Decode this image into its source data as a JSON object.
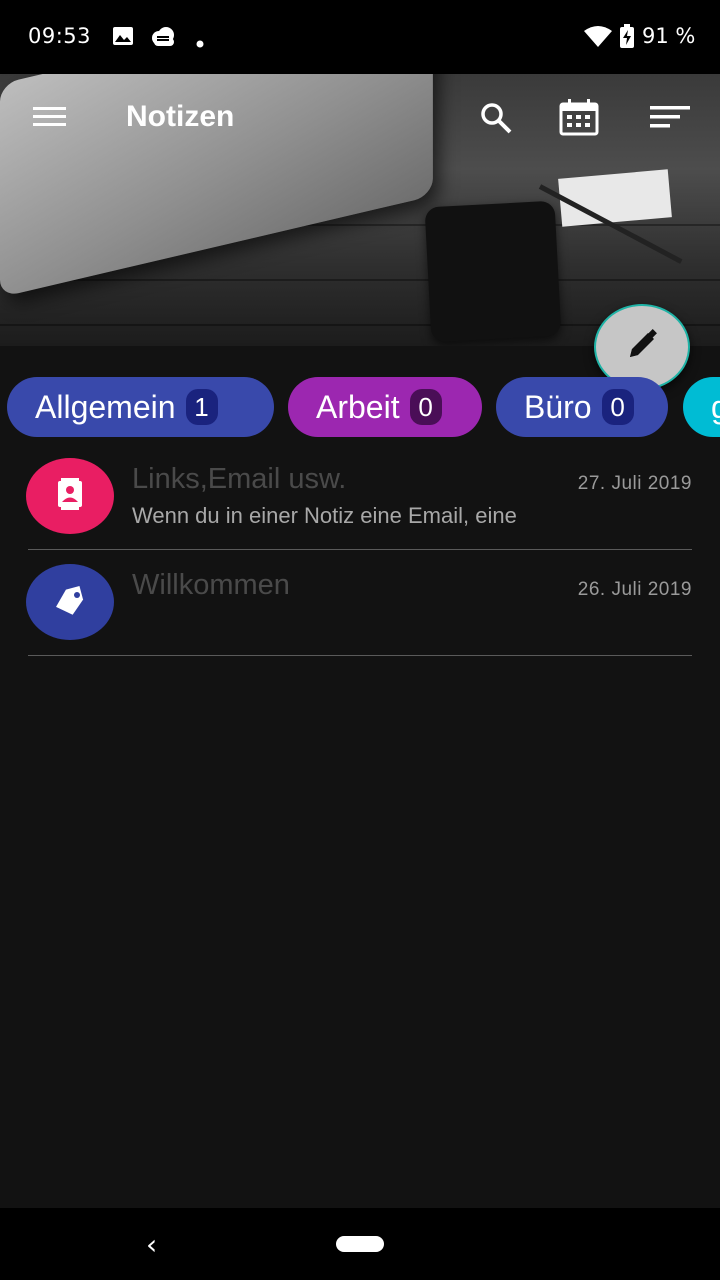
{
  "status_bar": {
    "time": "09:53",
    "battery": "91 %",
    "icons": [
      "image-icon",
      "cloud-icon",
      "dot-icon",
      "wifi-icon",
      "battery-charging-icon"
    ]
  },
  "toolbar": {
    "title": "Notizen",
    "icons": [
      "menu-icon",
      "search-icon",
      "calendar-icon",
      "sort-icon"
    ]
  },
  "fab": {
    "icon": "pencil-icon"
  },
  "categories": [
    {
      "label": "Allgemein",
      "count": "1",
      "color": "#3949ab",
      "count_bg": "#1a237e"
    },
    {
      "label": "Arbeit",
      "count": "0",
      "color": "#9c27b0",
      "count_bg": "#4a0e57"
    },
    {
      "label": "Büro",
      "count": "0",
      "color": "#3949ab",
      "count_bg": "#1a237e"
    },
    {
      "label": "g",
      "count": "",
      "color": "#00bcd4",
      "count_bg": "#00838f"
    }
  ],
  "notes": [
    {
      "title": "Links,Email usw.",
      "date": "27. Juli 2019",
      "snippet": "Wenn du in einer Notiz eine Email, eine",
      "icon": "contact-card-icon",
      "color": "#e91e63"
    },
    {
      "title": "Willkommen",
      "date": "26. Juli 2019",
      "snippet": "",
      "icon": "tag-icon",
      "color": "#303f9f"
    }
  ],
  "nav_bar": {
    "back": "‹"
  }
}
